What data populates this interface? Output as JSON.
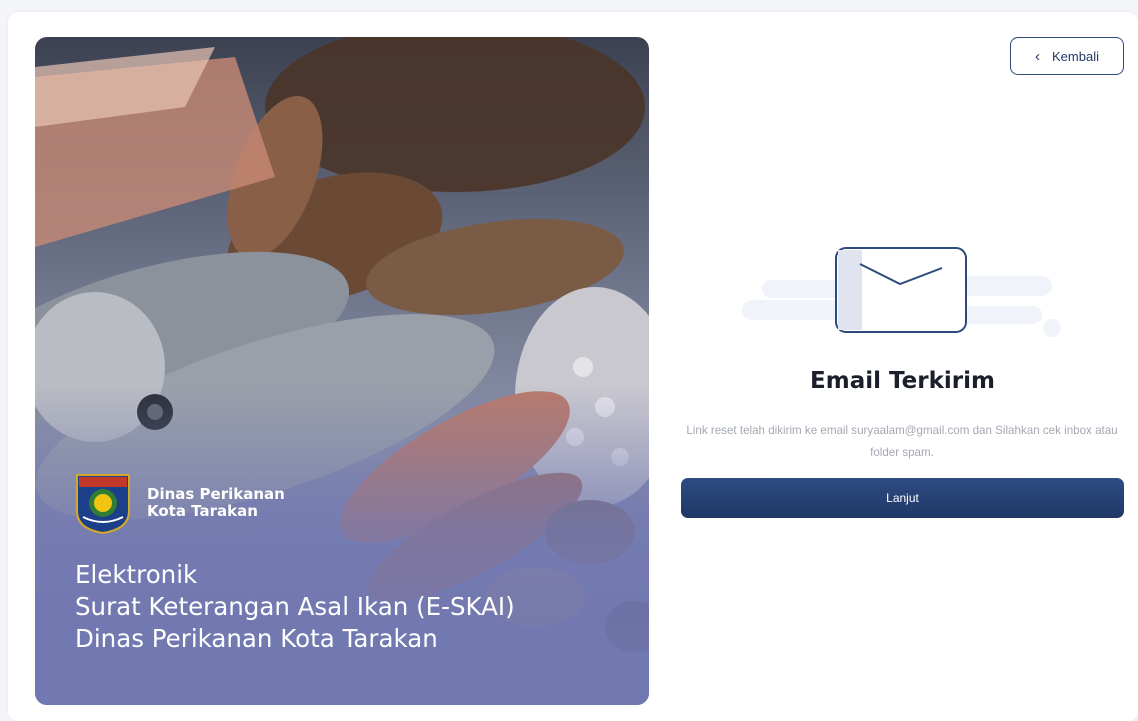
{
  "hero": {
    "org_name_line1": "Dinas Perikanan",
    "org_name_line2": "Kota Tarakan",
    "logo_text": "KOTA TARAKAN",
    "title_line1": "Elektronik",
    "title_line2": "Surat Keterangan Asal Ikan (E-SKAI)",
    "title_line3": "Dinas Perikanan Kota Tarakan"
  },
  "header": {
    "back_label": "Kembali",
    "back_icon": "chevron-left-icon"
  },
  "status": {
    "illustration": "envelope-icon",
    "title": "Email Terkirim",
    "message": "Link reset telah dikirim ke email suryaalam@gmail.com dan Silahkan cek inbox atau folder spam.",
    "next_label": "Lanjut"
  },
  "colors": {
    "primary": "#233a66",
    "hero_tint": "#7278b0",
    "muted_text": "#a3a8b2"
  }
}
